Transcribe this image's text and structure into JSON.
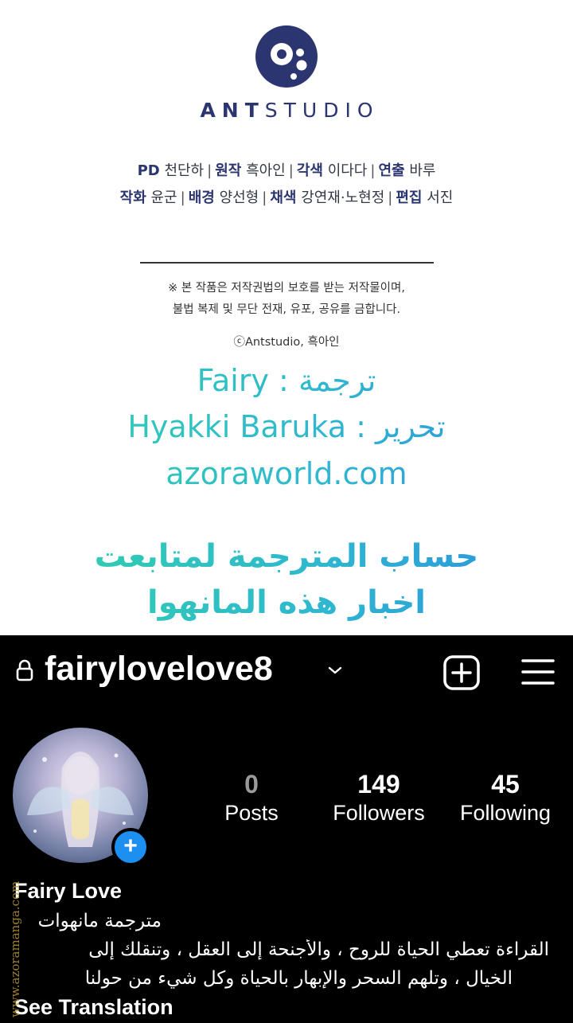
{
  "credits": {
    "logo_text_bold": "ANT",
    "logo_text_light": "STUDIO",
    "staff_line1": [
      {
        "role": "PD",
        "name": "천단하"
      },
      {
        "role": "원작",
        "name": "흑아인"
      },
      {
        "role": "각색",
        "name": "이다다"
      },
      {
        "role": "연출",
        "name": "바루"
      }
    ],
    "staff_line2": [
      {
        "role": "작화",
        "name": "윤군"
      },
      {
        "role": "배경",
        "name": "양선형"
      },
      {
        "role": "채색",
        "name": "강연재·노현정"
      },
      {
        "role": "편집",
        "name": "서진"
      }
    ],
    "separator": "|",
    "notice_line1": "※ 본 작품은 저작권법의 보호를 받는 저작물이며,",
    "notice_line2": "불법 복제 및 무단 전재, 유포, 공유를 금합니다.",
    "copyright": "ⓒAntstudio, 흑아인",
    "translation_line": "Fairy : ترجمة",
    "editing_line": "Hyakki Baruka : تحرير",
    "website": "azoraworld.com",
    "follow_line1": "حساب المترجمة لمتابعت",
    "follow_line2": "اخبار هذه المانهوا",
    "brand_color": "#2b3570"
  },
  "profile": {
    "username": "fairylovelove8",
    "stats": [
      {
        "value": "0",
        "label": "Posts"
      },
      {
        "value": "149",
        "label": "Followers"
      },
      {
        "value": "45",
        "label": "Following"
      }
    ],
    "display_name": "Fairy Love",
    "bio_line1": "مترجمة مانهوات",
    "bio_line2": "القراءة تعطي الحياة للروح ، والأجنحة إلى العقل ، وتنقلك إلى",
    "bio_line3": "الخيال ، وتلهم السحر والإبهار بالحياة وكل شيء من حولنا",
    "see_translation": "See Translation",
    "badge_symbol": "+",
    "badge_color": "#1d8ff0"
  },
  "watermark_text": "www.azoramanga.com"
}
